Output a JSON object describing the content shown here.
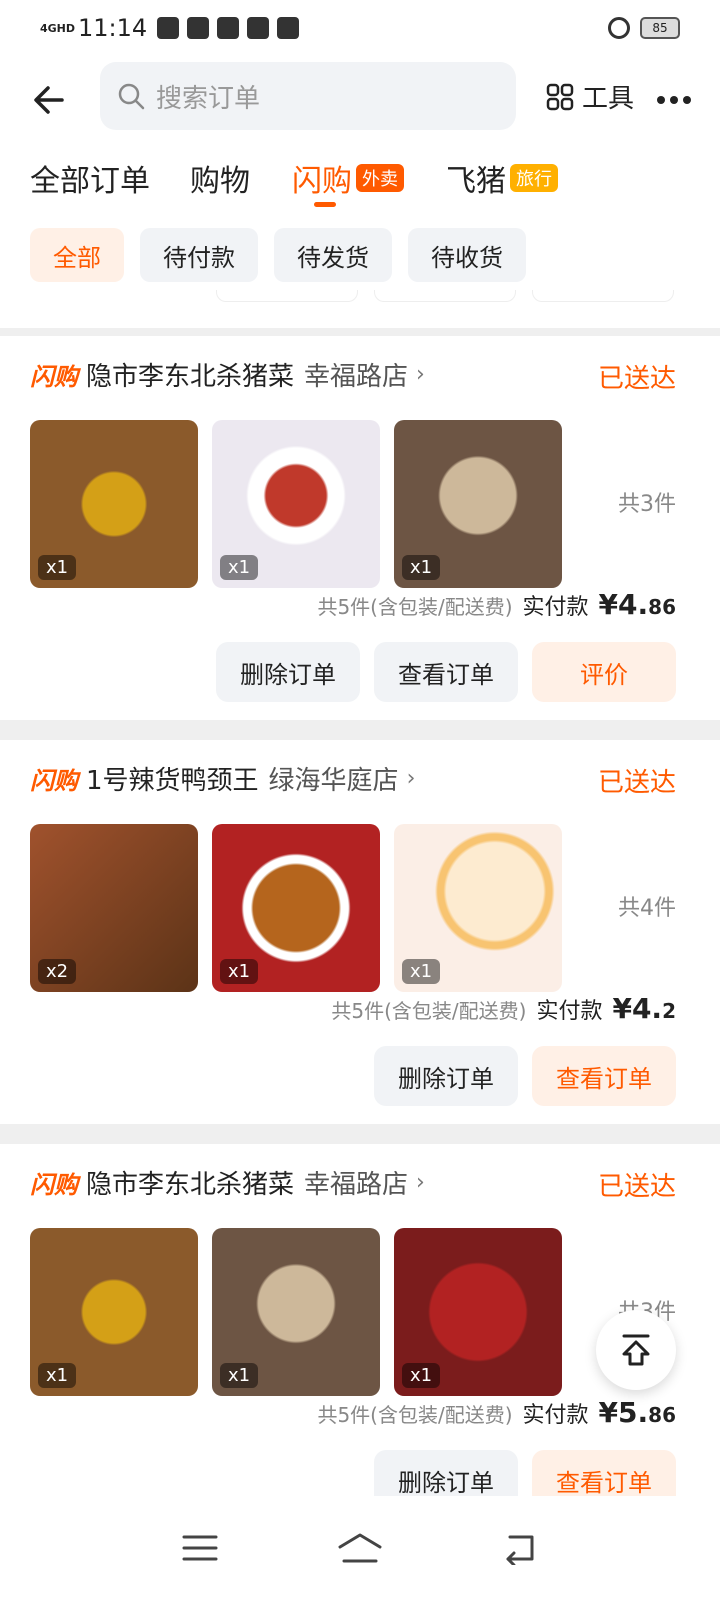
{
  "status_bar": {
    "time": "11:14",
    "network": "4GHD",
    "battery": "85"
  },
  "search": {
    "placeholder": "搜索订单"
  },
  "tools_label": "工具",
  "tabs": [
    {
      "label": "全部订单"
    },
    {
      "label": "购物"
    },
    {
      "label": "闪购",
      "badge": "外卖",
      "active": true
    },
    {
      "label": "飞猪",
      "badge": "旅行"
    }
  ],
  "subtabs": [
    {
      "label": "全部",
      "active": true
    },
    {
      "label": "待付款"
    },
    {
      "label": "待发货"
    },
    {
      "label": "待收货"
    }
  ],
  "orders": [
    {
      "logo": "闪购",
      "store": "隐市李东北杀猪菜",
      "branch": "幸福路店",
      "status": "已送达",
      "items": [
        {
          "qty": "x1",
          "color": "#b5651d",
          "icon": "sauce-bowl"
        },
        {
          "qty": "x1",
          "color": "#c0392b",
          "icon": "chili-oil-dish"
        },
        {
          "qty": "x1",
          "color": "#8d6e63",
          "icon": "pork-bones"
        }
      ],
      "item_count": "共3件",
      "note": "共5件(含包装/配送费)",
      "paid_label": "实付款",
      "amount": "¥4.86",
      "amount_int": "¥4.",
      "amount_dec": "86",
      "buttons": [
        "删除订单",
        "查看订单",
        "评价"
      ]
    },
    {
      "logo": "闪购",
      "store": "1号辣货鸭颈王",
      "branch": "绿海华庭店",
      "status": "已送达",
      "items": [
        {
          "qty": "x2",
          "color": "#8b4513",
          "icon": "duck-neck"
        },
        {
          "qty": "x1",
          "color": "#a0522d",
          "icon": "spicy-peanuts"
        },
        {
          "qty": "x1",
          "color": "#f5deb3",
          "icon": "lotus-root"
        }
      ],
      "item_count": "共4件",
      "note": "共5件(含包装/配送费)",
      "paid_label": "实付款",
      "amount": "¥4.2",
      "amount_int": "¥4.",
      "amount_dec": "2",
      "buttons": [
        "删除订单",
        "查看订单"
      ]
    },
    {
      "logo": "闪购",
      "store": "隐市李东北杀猪菜",
      "branch": "幸福路店",
      "status": "已送达",
      "items": [
        {
          "qty": "x1",
          "color": "#b5651d",
          "icon": "sauce-bowl"
        },
        {
          "qty": "x1",
          "color": "#8d6e63",
          "icon": "pork-bones"
        },
        {
          "qty": "x1",
          "color": "#b22222",
          "icon": "dried-chilies"
        }
      ],
      "item_count": "共3件",
      "note": "共5件(含包装/配送费)",
      "paid_label": "实付款",
      "amount": "¥5.86",
      "amount_int": "¥5.",
      "amount_dec": "86",
      "buttons": [
        "删除订单",
        "查看订单"
      ]
    }
  ],
  "colors": {
    "accent": "#ff5a00",
    "chip_bg": "#f1f3f6",
    "accent_bg": "#fff0e6"
  }
}
